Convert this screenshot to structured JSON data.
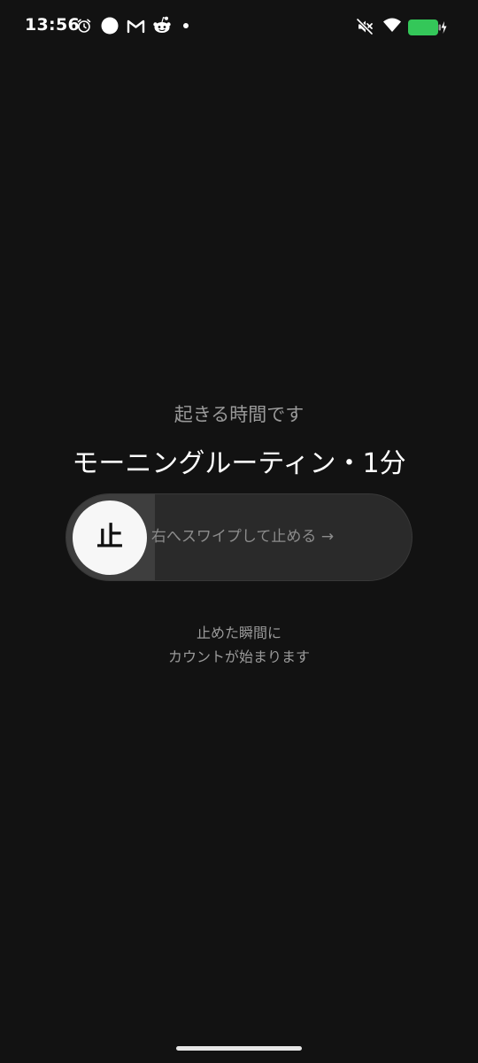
{
  "status_bar": {
    "time": "13:56",
    "icons": [
      "alarm-icon",
      "circle-icon",
      "mail-icon",
      "reddit-icon",
      "dot-icon",
      "mute-icon",
      "wifi-icon",
      "battery-icon"
    ],
    "battery_color": "#34C759"
  },
  "alarm": {
    "subtitle": "起きる時間です",
    "title": "モーニングルーティン・1分",
    "thumb_label": "止",
    "swipe_hint": "右へスワイプして止める →",
    "note_line1": "止めた瞬間に",
    "note_line2": "カウントが始まります"
  },
  "colors": {
    "background": "#121212",
    "track": "#2A2A2A",
    "thumb": "#F7F7F7"
  }
}
